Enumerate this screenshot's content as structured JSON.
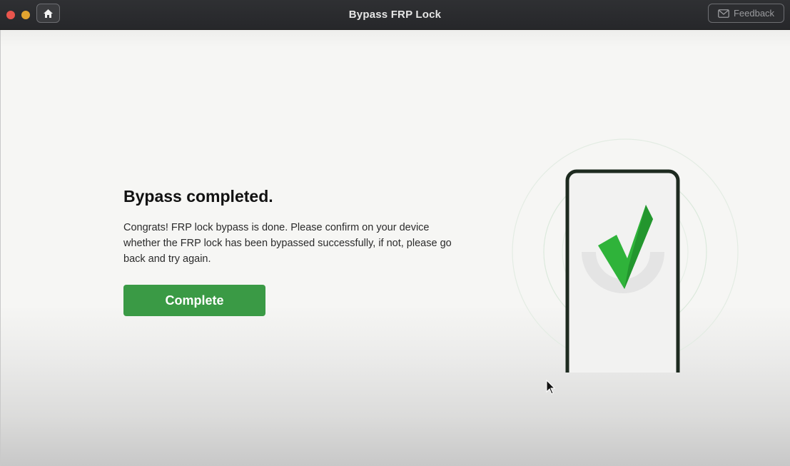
{
  "window": {
    "title": "Bypass FRP Lock",
    "feedback_label": "Feedback"
  },
  "main": {
    "heading": "Bypass completed.",
    "message": "Congrats! FRP lock bypass is done. Please confirm on your device whether the FRP lock has been bypassed successfully, if not, please go back and try again.",
    "complete_label": "Complete"
  },
  "icons": {
    "home": "home-icon",
    "feedback": "mail-icon",
    "illustration": "phone-check-icon"
  },
  "colors": {
    "accent_green": "#3a9a45",
    "check_green": "#2fb33a",
    "titlebar": "#2a2b2e"
  }
}
